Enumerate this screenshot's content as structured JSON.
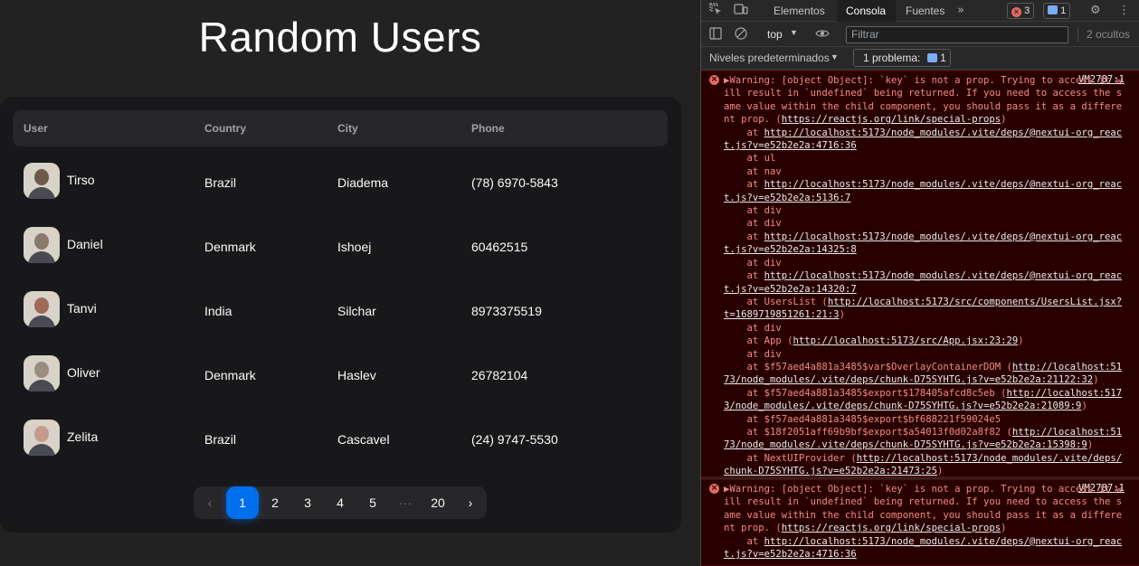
{
  "app": {
    "title": "Random Users",
    "columns": [
      "User",
      "Country",
      "City",
      "Phone"
    ],
    "users": [
      {
        "name": "Tirso",
        "country": "Brazil",
        "city": "Diadema",
        "phone": "(78) 6970-5843",
        "avatar_color": "#6b5a4a"
      },
      {
        "name": "Daniel",
        "country": "Denmark",
        "city": "Ishoej",
        "phone": "60462515",
        "avatar_color": "#8a7a6c"
      },
      {
        "name": "Tanvi",
        "country": "India",
        "city": "Silchar",
        "phone": "8973375519",
        "avatar_color": "#a06a5a"
      },
      {
        "name": "Oliver",
        "country": "Denmark",
        "city": "Haslev",
        "phone": "26782104",
        "avatar_color": "#9a8c7e"
      },
      {
        "name": "Zelita",
        "country": "Brazil",
        "city": "Cascavel",
        "phone": "(24) 9747-5530",
        "avatar_color": "#c79a8e"
      }
    ],
    "pagination": {
      "prev": "‹",
      "pages": [
        "1",
        "2",
        "3",
        "4",
        "5"
      ],
      "ellipsis": "···",
      "last": "20",
      "next": "›",
      "active": "1"
    },
    "accent": "#006fee"
  },
  "devtools": {
    "tabs": [
      "Elementos",
      "Consola",
      "Fuentes"
    ],
    "active_tab": "Consola",
    "error_count": "3",
    "info_count": "1",
    "context": "top",
    "filter_placeholder": "Filtrar",
    "hidden": "2 ocultos",
    "levels": "Niveles predeterminados",
    "problems": "1 problema:",
    "problems_count": "1",
    "messages": [
      {
        "source": "VM2787:1",
        "text": "▶Warning: [object Object]: `key` is not a prop. Trying to access it will result in `undefined` being returned. If you need to access the same value within the child component, you should pass it as a different prop. (https://reactjs.org/link/special-props)\n    at http://localhost:5173/node_modules/.vite/deps/@nextui-org_react.js?v=e52b2e2a:4716:36\n    at ul\n    at nav\n    at http://localhost:5173/node_modules/.vite/deps/@nextui-org_react.js?v=e52b2e2a:5136:7\n    at div\n    at div\n    at http://localhost:5173/node_modules/.vite/deps/@nextui-org_react.js?v=e52b2e2a:14325:8\n    at div\n    at http://localhost:5173/node_modules/.vite/deps/@nextui-org_react.js?v=e52b2e2a:14320:7\n    at UsersList (http://localhost:5173/src/components/UsersList.jsx?t=1689719851261:21:3)\n    at div\n    at App (http://localhost:5173/src/App.jsx:23:29)\n    at div\n    at $f57aed4a881a3485$var$OverlayContainerDOM (http://localhost:5173/node_modules/.vite/deps/chunk-D75SYHTG.js?v=e52b2e2a:21122:32)\n    at $f57aed4a881a3485$export$178405afcd8c5eb (http://localhost:5173/node_modules/.vite/deps/chunk-D75SYHTG.js?v=e52b2e2a:21089:9)\n    at $f57aed4a881a3485$export$bf688221f59024e5\n    at $18f2051aff69b9bf$export$a54013f0d02a8f82 (http://localhost:5173/node_modules/.vite/deps/chunk-D75SYHTG.js?v=e52b2e2a:15398:9)\n    at NextUIProvider (http://localhost:5173/node_modules/.vite/deps/chunk-D75SYHTG.js?v=e52b2e2a:21473:25)"
      },
      {
        "source": "VM2787:1",
        "text": "▶Warning: [object Object]: `key` is not a prop. Trying to access it will result in `undefined` being returned. If you need to access the same value within the child component, you should pass it as a different prop. (https://reactjs.org/link/special-props)\n    at http://localhost:5173/node_modules/.vite/deps/@nextui-org_react.js?v=e52b2e2a:4716:36"
      }
    ]
  }
}
